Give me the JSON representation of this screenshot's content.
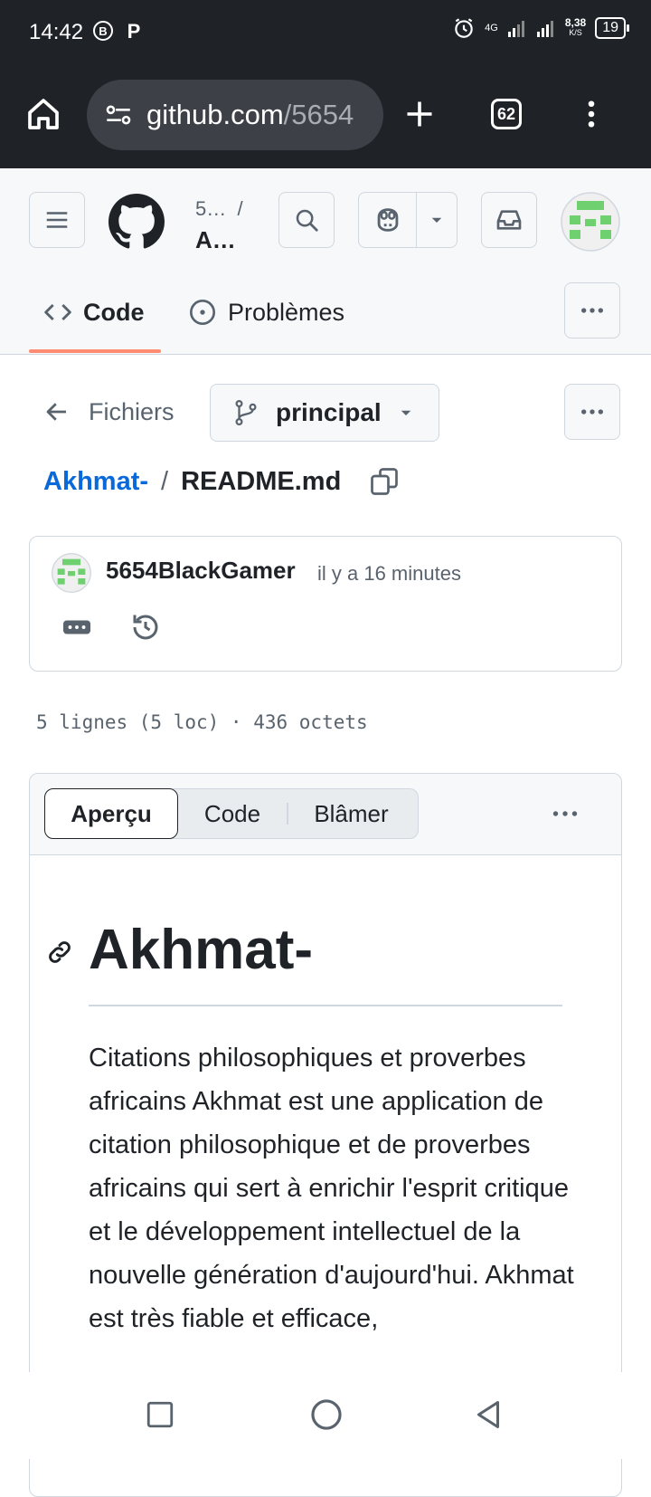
{
  "status_bar": {
    "time": "14:42",
    "network": "4G",
    "speed_value": "8,38",
    "speed_unit": "K/S",
    "battery": "19"
  },
  "browser": {
    "url_host": "github.com",
    "url_path": "/5654",
    "tab_count": "62"
  },
  "repo": {
    "owner": "5…",
    "separator": "/",
    "name": "A…"
  },
  "repo_tabs": [
    {
      "label": "Code"
    },
    {
      "label": "Problèmes"
    }
  ],
  "file_nav": {
    "back_label": "Fichiers",
    "branch": "principal"
  },
  "path": {
    "repo_link": "Akhmat-",
    "separator": "/",
    "file": "README.md"
  },
  "commit": {
    "author": "5654BlackGamer",
    "time": "il y a 16 minutes"
  },
  "file_info": "5 lignes (5 loc) · 436 octets",
  "viewer_tabs": [
    {
      "label": "Aperçu"
    },
    {
      "label": "Code"
    },
    {
      "label": "Blâmer"
    }
  ],
  "readme": {
    "title": "Akhmat-",
    "paragraph": "Citations philosophiques et proverbes africains Akhmat est une application de citation philosophique et de proverbes africains qui sert à enrichir l'esprit critique et le développement intellectuel de la nouvelle génération d'aujourd'hui. Akhmat est très fiable et efficace,"
  },
  "colors": {
    "link": "#0969da",
    "tab_underline": "#fd8c73",
    "avatar_green": "#6fd06f",
    "browser_bg": "#1f2328"
  }
}
